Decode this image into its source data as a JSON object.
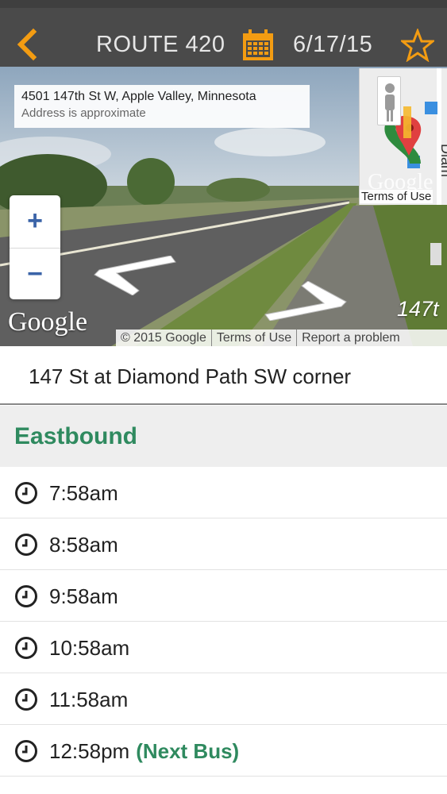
{
  "header": {
    "title": "ROUTE 420",
    "date": "6/17/15",
    "back_icon": "chevron-left-icon",
    "calendar_icon": "calendar-icon",
    "favorite_icon": "star-outline-icon",
    "accent_color": "#f39c12",
    "bar_color": "#4a4a4a"
  },
  "street_view": {
    "address": "4501 147th St W, Apple Valley, Minnesota",
    "address_note": "Address is approximate",
    "logo_text": "Google",
    "road_label": "147t",
    "zoom_in_label": "+",
    "zoom_out_label": "−",
    "attribution": {
      "copyright": "© 2015 Google",
      "terms": "Terms of Use",
      "report": "Report a problem"
    },
    "minimap": {
      "logo_text": "Google",
      "terms": "Terms of Use",
      "street": "Diam"
    }
  },
  "stop": {
    "name": "147 St at Diamond Path SW corner"
  },
  "direction": {
    "label": "Eastbound",
    "color": "#2f8a5f"
  },
  "times": [
    {
      "time": "7:58am",
      "tag": ""
    },
    {
      "time": "8:58am",
      "tag": ""
    },
    {
      "time": "9:58am",
      "tag": ""
    },
    {
      "time": "10:58am",
      "tag": ""
    },
    {
      "time": "11:58am",
      "tag": ""
    },
    {
      "time": "12:58pm",
      "tag": "(Next Bus)"
    }
  ]
}
